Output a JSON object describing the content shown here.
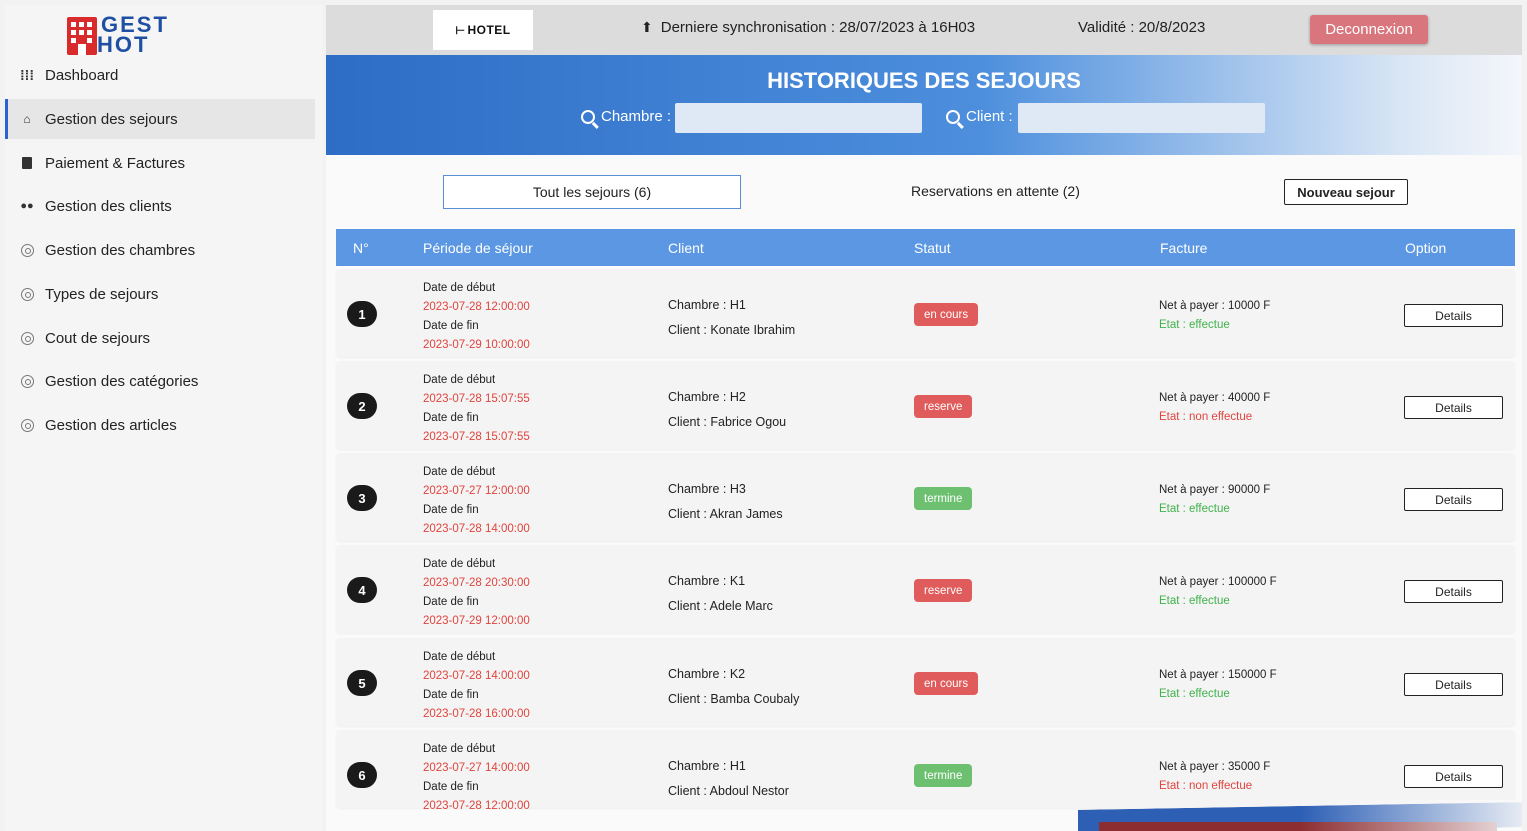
{
  "brand": {
    "logo_line1": "GEST",
    "logo_line2": "HOT",
    "hotel_logo": "HOTEL"
  },
  "sidebar": {
    "items": [
      {
        "label": "Dashboard",
        "icon": "grid-icon",
        "active": false
      },
      {
        "label": "Gestion des sejours",
        "icon": "home-icon",
        "active": true
      },
      {
        "label": "Paiement & Factures",
        "icon": "clipboard-icon",
        "active": false
      },
      {
        "label": "Gestion des clients",
        "icon": "people-icon",
        "active": false
      },
      {
        "label": "Gestion des chambres",
        "icon": "gear-icon",
        "active": false
      },
      {
        "label": "Types de sejours",
        "icon": "gear-icon",
        "active": false
      },
      {
        "label": "Cout de sejours",
        "icon": "gear-icon",
        "active": false
      },
      {
        "label": "Gestion des catégories",
        "icon": "gear-icon",
        "active": false
      },
      {
        "label": "Gestion des articles",
        "icon": "gear-icon",
        "active": false
      }
    ]
  },
  "topbar": {
    "sync": "Derniere synchronisation : 28/07/2023 à 16H03",
    "validite": "Validité : 20/8/2023",
    "logout": "Deconnexion"
  },
  "banner": {
    "title": "HISTORIQUES DES SEJOURS",
    "search_room_label": "Chambre :",
    "search_client_label": "Client :",
    "search_room_value": "",
    "search_client_value": ""
  },
  "tabs": {
    "all": "Tout les sejours (6)",
    "waiting": "Reservations en attente (2)",
    "new_button": "Nouveau sejour"
  },
  "table": {
    "headers": [
      "N°",
      "Période de séjour",
      "Client",
      "Statut",
      "Facture",
      "Option"
    ],
    "rows": [
      {
        "n": "1",
        "start_label": "Date de début",
        "start": "2023-07-28 12:00:00",
        "end_label": "Date de fin",
        "end": "2023-07-29 10:00:00",
        "room": "Chambre : H1",
        "client": "Client : Konate Ibrahim",
        "status": "en cours",
        "net": "Net à payer : 10000 F",
        "etat": "Etat : effectue",
        "etat_ok": true,
        "option": "Details"
      },
      {
        "n": "2",
        "start_label": "Date de début",
        "start": "2023-07-28 15:07:55",
        "end_label": "Date de fin",
        "end": "2023-07-28 15:07:55",
        "room": "Chambre : H2",
        "client": "Client : Fabrice Ogou",
        "status": "reserve",
        "net": "Net à payer : 40000 F",
        "etat": "Etat : non effectue",
        "etat_ok": false,
        "option": "Details"
      },
      {
        "n": "3",
        "start_label": "Date de début",
        "start": "2023-07-27 12:00:00",
        "end_label": "Date de fin",
        "end": "2023-07-28 14:00:00",
        "room": "Chambre : H3",
        "client": "Client : Akran James",
        "status": "termine",
        "net": "Net à payer : 90000 F",
        "etat": "Etat : effectue",
        "etat_ok": true,
        "option": "Details"
      },
      {
        "n": "4",
        "start_label": "Date de début",
        "start": "2023-07-28 20:30:00",
        "end_label": "Date de fin",
        "end": "2023-07-29 12:00:00",
        "room": "Chambre : K1",
        "client": "Client : Adele Marc",
        "status": "reserve",
        "net": "Net à payer : 100000 F",
        "etat": "Etat : effectue",
        "etat_ok": true,
        "option": "Details"
      },
      {
        "n": "5",
        "start_label": "Date de début",
        "start": "2023-07-28 14:00:00",
        "end_label": "Date de fin",
        "end": "2023-07-28 16:00:00",
        "room": "Chambre : K2",
        "client": "Client : Bamba Coubaly",
        "status": "en cours",
        "net": "Net à payer : 150000 F",
        "etat": "Etat : effectue",
        "etat_ok": true,
        "option": "Details"
      },
      {
        "n": "6",
        "start_label": "Date de début",
        "start": "2023-07-27 14:00:00",
        "end_label": "Date de fin",
        "end": "2023-07-28 12:00:00",
        "room": "Chambre : H1",
        "client": "Client : Abdoul Nestor",
        "status": "termine",
        "net": "Net à payer : 35000 F",
        "etat": "Etat : non effectue",
        "etat_ok": false,
        "option": "Details"
      }
    ]
  },
  "colors": {
    "status_en_cours": "#e05b5b",
    "status_reserve": "#e05b5b",
    "status_termine": "#6cc070",
    "accent": "#5b97e2"
  }
}
